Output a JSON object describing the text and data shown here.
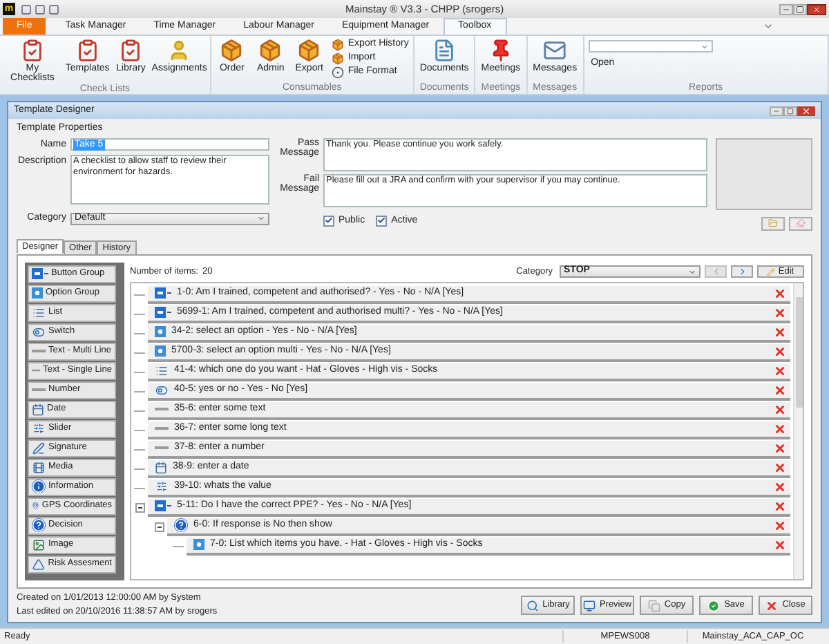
{
  "window": {
    "logo": "m",
    "title": "Mainstay ® V3.3 - CHPP (srogers)"
  },
  "ribbon": {
    "tabs": [
      {
        "label": "File",
        "kind": "file",
        "selected": false
      },
      {
        "label": "Task Manager",
        "kind": "tab",
        "selected": false
      },
      {
        "label": "Time Manager",
        "kind": "tab",
        "selected": false
      },
      {
        "label": "Labour Manager",
        "kind": "tab",
        "selected": false
      },
      {
        "label": "Equipment Manager",
        "kind": "tab",
        "selected": false
      },
      {
        "label": "Toolbox",
        "kind": "tab",
        "selected": true
      }
    ],
    "groups": [
      {
        "label": "Check Lists",
        "kind": "buttons",
        "buttons": [
          {
            "label": "My Checklists",
            "kind": "large"
          },
          {
            "label": "Templates",
            "kind": "large"
          },
          {
            "label": "Library",
            "kind": "large"
          },
          {
            "label": "Assignments",
            "kind": "large"
          }
        ]
      },
      {
        "label": "Consumables",
        "kind": "buttons",
        "buttons": [
          {
            "label": "Order",
            "kind": "large"
          },
          {
            "label": "Admin",
            "kind": "large"
          },
          {
            "label": "Export",
            "kind": "large"
          },
          {
            "label": "Export History",
            "kind": "small"
          },
          {
            "label": "Import",
            "kind": "small"
          },
          {
            "label": "File Format",
            "kind": "small"
          }
        ]
      },
      {
        "label": "Documents",
        "kind": "buttons",
        "buttons": [
          {
            "label": "Documents",
            "kind": "large"
          }
        ]
      },
      {
        "label": "Meetings",
        "kind": "buttons",
        "buttons": [
          {
            "label": "Meetings",
            "kind": "large"
          }
        ]
      },
      {
        "label": "Messages",
        "kind": "buttons",
        "buttons": [
          {
            "label": "Messages",
            "kind": "large"
          }
        ]
      },
      {
        "label": "Reports",
        "kind": "picker",
        "buttons": [
          {
            "label": "Open"
          }
        ]
      }
    ]
  },
  "designer": {
    "title": "Template Designer",
    "properties": {
      "heading": "Template Properties",
      "name_label": "Name",
      "name": "Take 5",
      "description_label": "Description",
      "description": "A checklist to allow staff to review their environment for hazards.",
      "category_label": "Category",
      "category": "Default",
      "pass_label": "Pass Message",
      "pass": "Thank you. Please continue you work safely.",
      "fail_label": "Fail Message",
      "fail": "Please fill out a JRA and confirm with your supervisor if you may continue.",
      "public": {
        "label": "Public",
        "checked": true
      },
      "active": {
        "label": "Active",
        "checked": true
      }
    },
    "tabs": [
      {
        "label": "Designer",
        "selected": true
      },
      {
        "label": "Other",
        "selected": false
      },
      {
        "label": "History",
        "selected": false
      }
    ],
    "palette": [
      {
        "label": "Button Group",
        "kind": "button_group"
      },
      {
        "label": "Option Group",
        "kind": "option_group"
      },
      {
        "label": "List",
        "kind": "list"
      },
      {
        "label": "Switch",
        "kind": "switch"
      },
      {
        "label": "Text - Multi Line",
        "kind": "text"
      },
      {
        "label": "Text - Single Line",
        "kind": "text"
      },
      {
        "label": "Number",
        "kind": "text"
      },
      {
        "label": "Date",
        "kind": "date"
      },
      {
        "label": "Slider",
        "kind": "slider"
      },
      {
        "label": "Signature",
        "kind": "signature"
      },
      {
        "label": "Media",
        "kind": "media"
      },
      {
        "label": "Information",
        "kind": "information"
      },
      {
        "label": "GPS Coordinates",
        "kind": "gps"
      },
      {
        "label": "Decision",
        "kind": "decision"
      },
      {
        "label": "Image",
        "kind": "image"
      },
      {
        "label": "Risk Assesment",
        "kind": "risk"
      }
    ],
    "count_label": "Number of items:",
    "count": "20",
    "category_label": "Category",
    "category": "STOP",
    "edit_button": "Edit",
    "items": [
      {
        "text": "1-0: Am I trained, competent and authorised? - Yes - No - N/A [Yes]",
        "kind": "button_group"
      },
      {
        "text": "5699-1: Am I trained, competent and authorised multi? - Yes - No - N/A [Yes]",
        "kind": "button_group"
      },
      {
        "text": "34-2: select an option - Yes - No - N/A [Yes]",
        "kind": "option_group"
      },
      {
        "text": "5700-3: select an option multi - Yes - No - N/A [Yes]",
        "kind": "option_group"
      },
      {
        "text": "41-4: which one do you want - Hat - Gloves - High vis - Socks",
        "kind": "list"
      },
      {
        "text": "40-5: yes or no - Yes - No [Yes]",
        "kind": "switch"
      },
      {
        "text": "35-6: enter some text",
        "kind": "text"
      },
      {
        "text": "36-7: enter some long text",
        "kind": "text"
      },
      {
        "text": "37-8: enter a number",
        "kind": "text"
      },
      {
        "text": "38-9: enter a date",
        "kind": "date"
      },
      {
        "text": "39-10: whats the value",
        "kind": "slider"
      },
      {
        "text": "5-11: Do I have the correct PPE? - Yes - No - N/A [Yes]",
        "kind": "button_group",
        "expanded": true,
        "children": [
          {
            "text": "6-0: If response is No then show",
            "kind": "decision",
            "expanded": true,
            "children": [
              {
                "text": "7-0: List which items you have. - Hat - Gloves - High vis - Socks",
                "kind": "option_group"
              }
            ]
          }
        ]
      }
    ],
    "created": "Created on 1/01/2013 12:00:00 AM by System",
    "edited": "Last edited on 20/10/2016 11:38:57 AM by srogers",
    "actions": [
      {
        "label": "Library",
        "kind": "library"
      },
      {
        "label": "Preview",
        "kind": "preview"
      },
      {
        "label": "Copy",
        "kind": "copy"
      },
      {
        "label": "Save",
        "kind": "save"
      },
      {
        "label": "Close",
        "kind": "close"
      }
    ]
  },
  "status_bar": {
    "text": "Ready",
    "machine": "MPEWS008",
    "database": "Mainstay_ACA_CAP_OC"
  }
}
